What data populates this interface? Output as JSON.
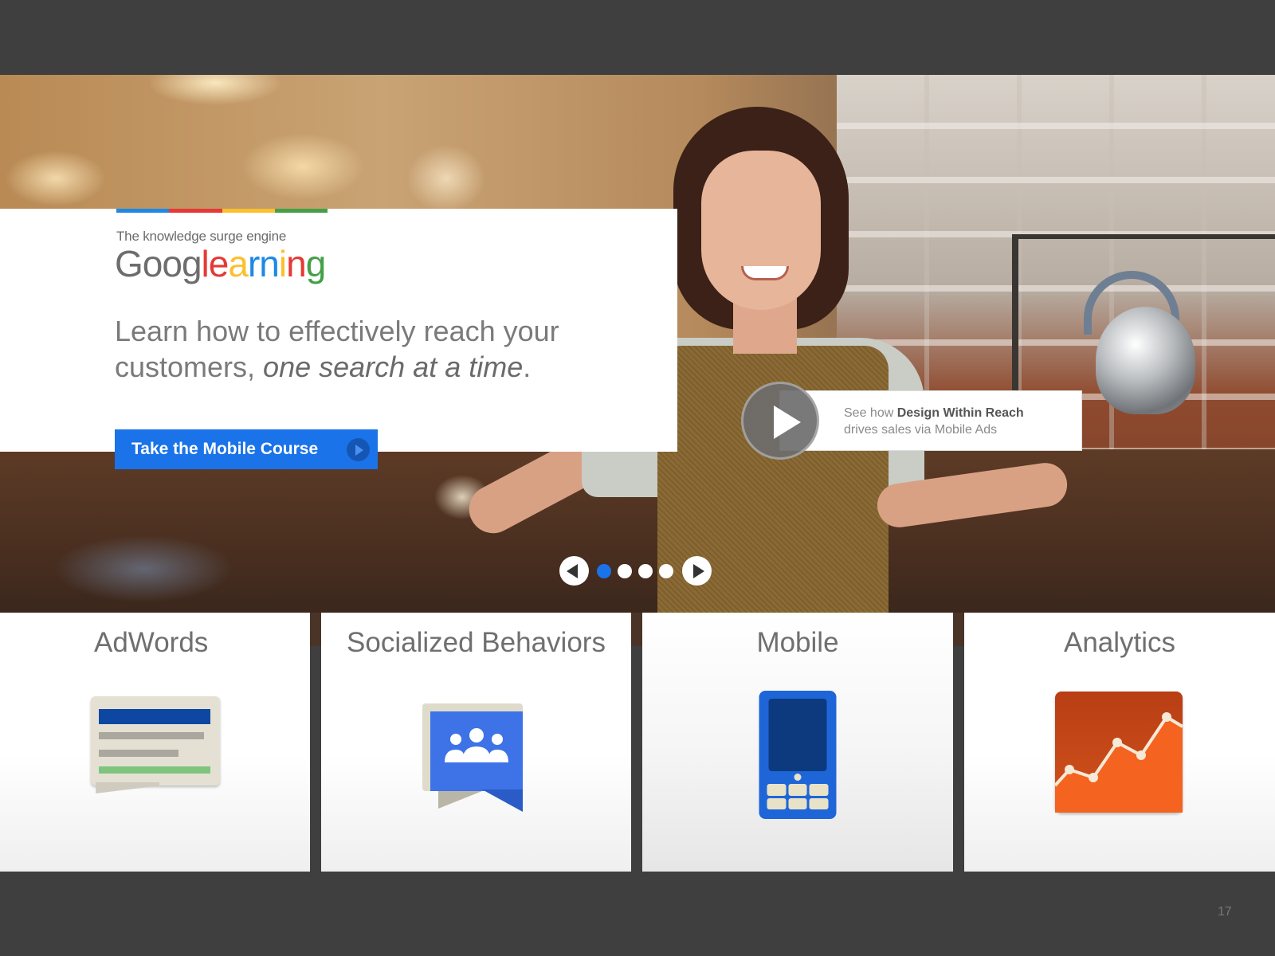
{
  "brand": {
    "tagline": "The knowledge surge engine",
    "logo_parts": [
      {
        "text": "Goog",
        "color": "#6d6d6d"
      },
      {
        "text": "l",
        "color": "#e53935"
      },
      {
        "text": "e",
        "color": "#e53935"
      },
      {
        "text": "a",
        "color": "#fbc02d"
      },
      {
        "text": "r",
        "color": "#1e88e5"
      },
      {
        "text": "n",
        "color": "#1e88e5"
      },
      {
        "text": "i",
        "color": "#fbc02d"
      },
      {
        "text": "n",
        "color": "#e53935"
      },
      {
        "text": "g",
        "color": "#43a047"
      }
    ],
    "color_bar": [
      "#1e88e5",
      "#e53935",
      "#fbc02d",
      "#43a047"
    ]
  },
  "hero": {
    "headline_plain": "Learn how to effectively reach your customers, ",
    "headline_emphasis": "one search at a time",
    "headline_end": ".",
    "cta_label": "Take the Mobile Course",
    "video_prefix": "See how ",
    "video_bold": "Design Within Reach",
    "video_suffix": "drives sales via Mobile Ads"
  },
  "carousel": {
    "total_dots": 4,
    "active_index": 0
  },
  "categories": [
    {
      "title": "AdWords",
      "icon": "adwords-icon"
    },
    {
      "title": "Socialized Behaviors",
      "icon": "google-groups-icon"
    },
    {
      "title": "Mobile",
      "icon": "mobile-phone-icon"
    },
    {
      "title": "Analytics",
      "icon": "analytics-chart-icon"
    }
  ],
  "colors": {
    "accent_blue": "#1a73e8",
    "frame": "#3f3f3f"
  },
  "page_number": "17"
}
